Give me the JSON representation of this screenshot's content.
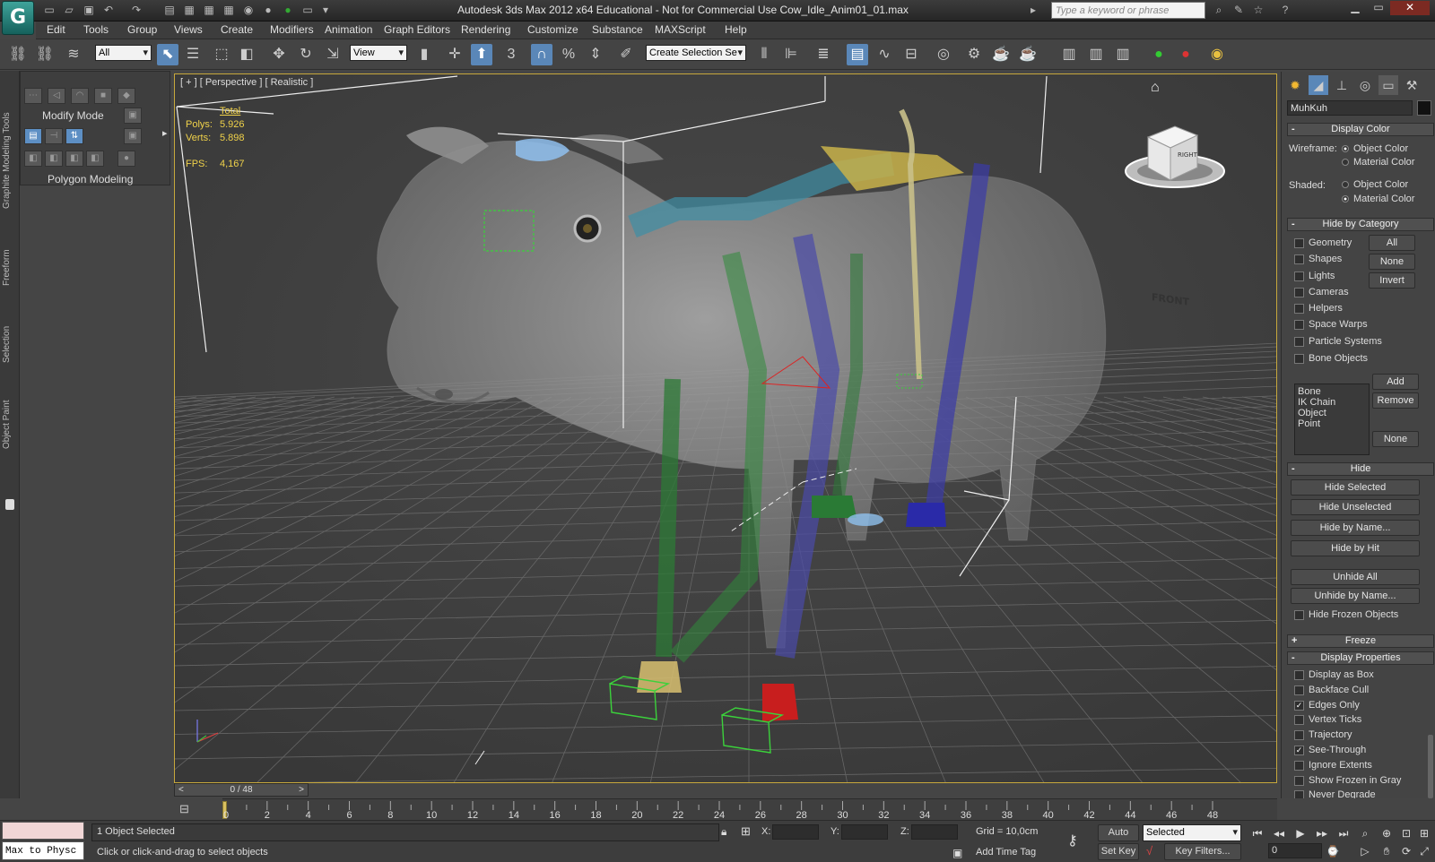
{
  "app": {
    "title": "Autodesk 3ds Max  2012 x64    Educational - Not for Commercial Use    Cow_Idle_Anim01_01.max",
    "search_placeholder": "Type a keyword or phrase",
    "logo_glyph": "G"
  },
  "menu": [
    "Edit",
    "Tools",
    "Group",
    "Views",
    "Create",
    "Modifiers",
    "Animation",
    "Graph Editors",
    "Rendering",
    "Customize",
    "Substance",
    "MAXScript",
    "Help"
  ],
  "toolbar": {
    "selection_filter": "All",
    "reference_coord": "View",
    "named_selection": "Create Selection Se",
    "snap_label": "3"
  },
  "ribbon": {
    "modify_mode": "Modify Mode",
    "polygon_modeling": "Polygon Modeling",
    "vertical_tabs": [
      "Graphite Modeling Tools",
      "Freeform",
      "Selection",
      "Object Paint"
    ]
  },
  "viewport": {
    "label": "[ + ] [ Perspective ] [ Realistic ]",
    "stats": {
      "total_label": "Total",
      "polys_label": "Polys:",
      "polys": "5.926",
      "verts_label": "Verts:",
      "verts": "5.898",
      "fps_label": "FPS:",
      "fps": "4,167"
    },
    "viewcube": {
      "front": "FRONT",
      "right": "RIGHT"
    },
    "home_icon": "home-icon"
  },
  "timeline": {
    "slider_text": "0 / 48",
    "ticks": [
      "0",
      "2",
      "4",
      "6",
      "8",
      "10",
      "12",
      "14",
      "16",
      "18",
      "20",
      "22",
      "24",
      "26",
      "28",
      "30",
      "32",
      "34",
      "36",
      "38",
      "40",
      "42",
      "44",
      "46",
      "48"
    ]
  },
  "command_panel": {
    "object_name": "MuhKuh",
    "display_color": {
      "header": "Display Color",
      "wireframe_label": "Wireframe:",
      "shaded_label": "Shaded:",
      "object_color": "Object Color",
      "material_color": "Material Color"
    },
    "hide_by_category": {
      "header": "Hide by Category",
      "items": [
        "Geometry",
        "Shapes",
        "Lights",
        "Cameras",
        "Helpers",
        "Space Warps",
        "Particle Systems",
        "Bone Objects"
      ],
      "all": "All",
      "none": "None",
      "invert": "Invert",
      "list": [
        "Bone",
        "IK Chain Object",
        "Point"
      ],
      "add": "Add",
      "remove": "Remove",
      "none2": "None"
    },
    "hide": {
      "header": "Hide",
      "hide_selected": "Hide Selected",
      "hide_unselected": "Hide Unselected",
      "hide_by_name": "Hide by Name...",
      "hide_by_hit": "Hide by Hit",
      "unhide_all": "Unhide All",
      "unhide_by_name": "Unhide by Name...",
      "hide_frozen": "Hide Frozen Objects"
    },
    "freeze": {
      "header": "Freeze"
    },
    "display_properties": {
      "header": "Display Properties",
      "items": [
        "Display as Box",
        "Backface Cull",
        "Edges Only",
        "Vertex Ticks",
        "Trajectory",
        "See-Through",
        "Ignore Extents",
        "Show Frozen in Gray",
        "Never Degrade"
      ],
      "checked": [
        "Edges Only",
        "See-Through"
      ]
    }
  },
  "status": {
    "maxscript_text": "Max to Physc",
    "selection": "1 Object Selected",
    "prompt": "Click or click-and-drag to select objects",
    "x_label": "X:",
    "y_label": "Y:",
    "z_label": "Z:",
    "grid": "Grid = 10,0cm",
    "add_time_tag": "Add Time Tag",
    "auto_key": "Auto Key",
    "set_key": "Set Key",
    "key_mode": "Selected",
    "key_filters": "Key Filters...",
    "frame": "0"
  },
  "colors": {
    "accent": "#5a87b8",
    "viewport_border": "#c7a83c",
    "stats": "#f0d24a",
    "grid": "#6b6b6b"
  }
}
